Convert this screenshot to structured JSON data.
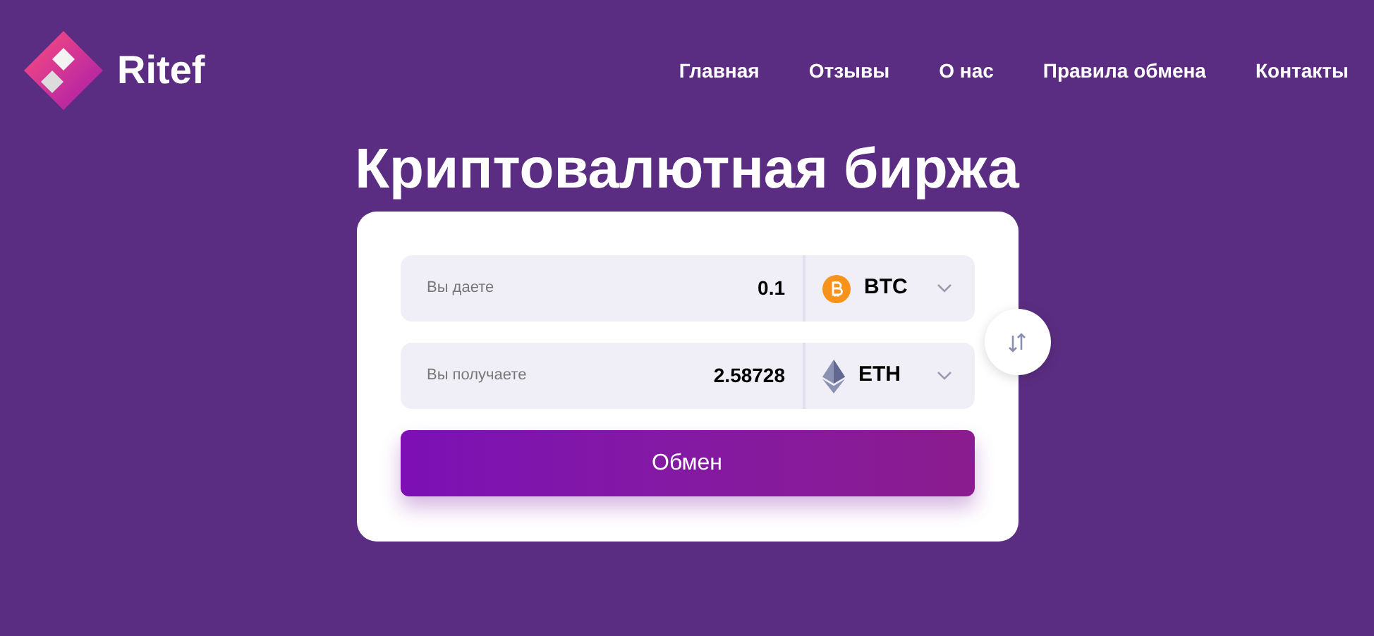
{
  "logo": {
    "name": "Ritef"
  },
  "nav": [
    "Главная",
    "Отзывы",
    "О нас",
    "Правила обмена",
    "Контакты"
  ],
  "title": "Криптовалютная биржа",
  "rows": [
    {
      "label": "Вы даете",
      "value": "0.1",
      "currency": {
        "kind": "btc",
        "code": "BTC"
      }
    },
    {
      "label": "Вы получаете",
      "value": "2.58728",
      "currency": {
        "kind": "eth",
        "code": "ETH"
      }
    }
  ],
  "submit": "Обмен"
}
